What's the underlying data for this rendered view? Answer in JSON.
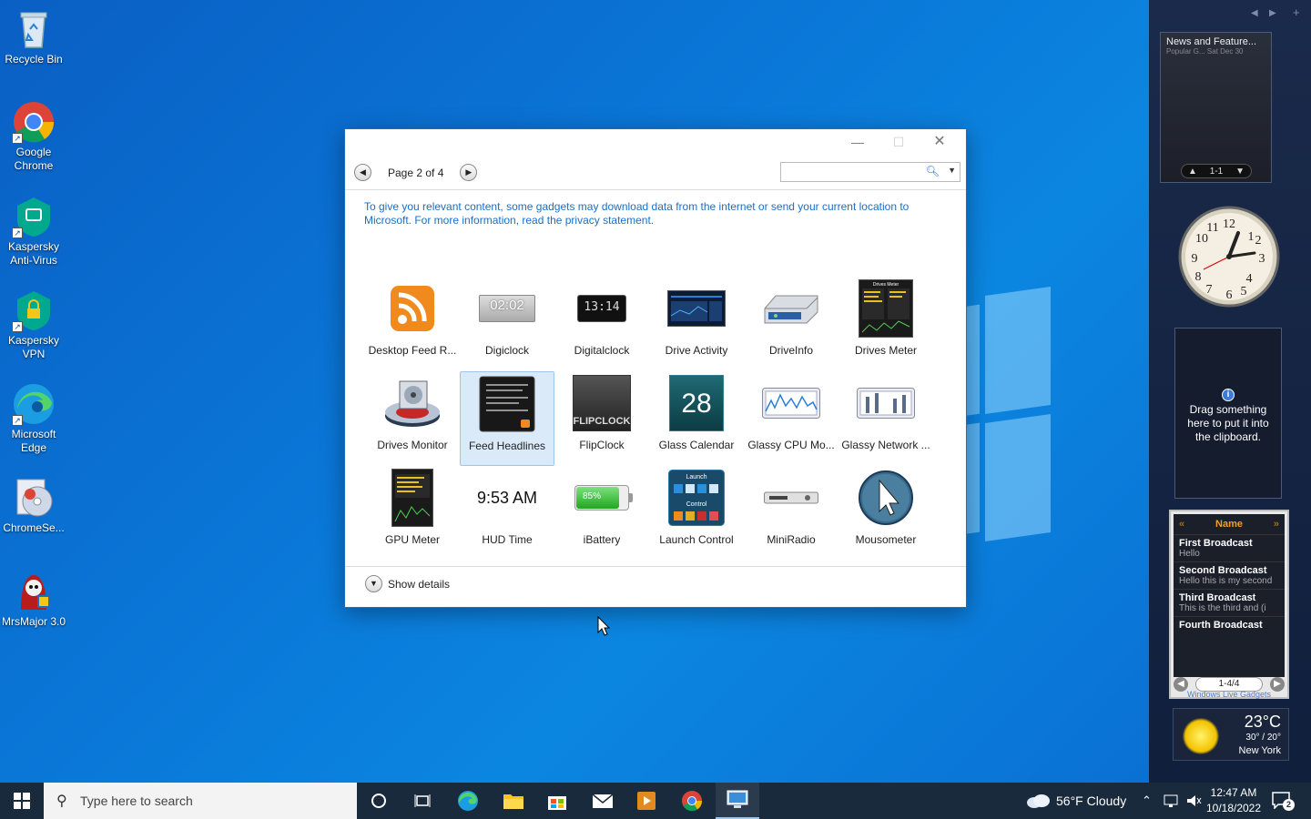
{
  "desktop": {
    "icons": [
      {
        "label": "Recycle Bin"
      },
      {
        "label": "Google Chrome"
      },
      {
        "label": "Kaspersky Anti-Virus"
      },
      {
        "label": "Kaspersky VPN"
      },
      {
        "label": "Microsoft Edge"
      },
      {
        "label": "ChromeSe..."
      },
      {
        "label": "MrsMajor 3.0"
      }
    ]
  },
  "dialog": {
    "page_label": "Page 2 of 4",
    "search_placeholder": "",
    "privacy_text": "To give you relevant content, some gadgets may download data from the internet or send your current location to Microsoft. For more information, read the privacy statement.",
    "gadgets": [
      {
        "label": "Desktop Feed R...",
        "icon": "rss-feed-icon"
      },
      {
        "label": "Digiclock",
        "icon": "digiclock-icon",
        "text": "02:02"
      },
      {
        "label": "Digitalclock",
        "icon": "digitalclock-icon",
        "text": "13:14"
      },
      {
        "label": "Drive Activity",
        "icon": "drive-activity-icon"
      },
      {
        "label": "DriveInfo",
        "icon": "drive-info-icon"
      },
      {
        "label": "Drives Meter",
        "icon": "drives-meter-icon",
        "text": "Drives Meter"
      },
      {
        "label": "Drives Monitor",
        "icon": "drives-monitor-icon"
      },
      {
        "label": "Feed Headlines",
        "icon": "feed-headlines-icon",
        "selected": true
      },
      {
        "label": "FlipClock",
        "icon": "flipclock-icon",
        "text": "FLIPCLOCK"
      },
      {
        "label": "Glass Calendar",
        "icon": "glass-calendar-icon",
        "text": "28"
      },
      {
        "label": "Glassy CPU Mo...",
        "icon": "cpu-monitor-icon"
      },
      {
        "label": "Glassy Network ...",
        "icon": "network-monitor-icon"
      },
      {
        "label": "GPU Meter",
        "icon": "gpu-meter-icon"
      },
      {
        "label": "HUD Time",
        "icon": "hud-time-icon",
        "text": "9:53 AM"
      },
      {
        "label": "iBattery",
        "icon": "battery-icon",
        "text": "85%"
      },
      {
        "label": "Launch Control",
        "icon": "launch-control-icon",
        "text": "Launch"
      },
      {
        "label": "MiniRadio",
        "icon": "radio-icon"
      },
      {
        "label": "Mousometer",
        "icon": "cursor-icon"
      }
    ],
    "show_details": "Show details",
    "battery_level": 0.85
  },
  "sidebar": {
    "news": {
      "title": "News and Feature...",
      "subtitle": "Popular G...   Sat Dec 30",
      "pager": "1-1"
    },
    "clipboard_text": "Drag something here to put it into the clipboard.",
    "broadcast": {
      "header": "Name",
      "items": [
        {
          "title": "First Broadcast",
          "sub": "Hello"
        },
        {
          "title": "Second Broadcast",
          "sub": "Hello this is my second"
        },
        {
          "title": "Third Broadcast",
          "sub": "This is the third and (i"
        },
        {
          "title": "Fourth Broadcast",
          "sub": ""
        }
      ],
      "pager": "1-4/4",
      "footer": "Windows Live Gadgets"
    },
    "weather": {
      "temp": "23°C",
      "range": "30° / 20°",
      "city": "New York"
    }
  },
  "taskbar": {
    "search_placeholder": "Type here to search",
    "weather": "56°F  Cloudy",
    "time": "12:47 AM",
    "date": "10/18/2022",
    "notifications": "2"
  }
}
